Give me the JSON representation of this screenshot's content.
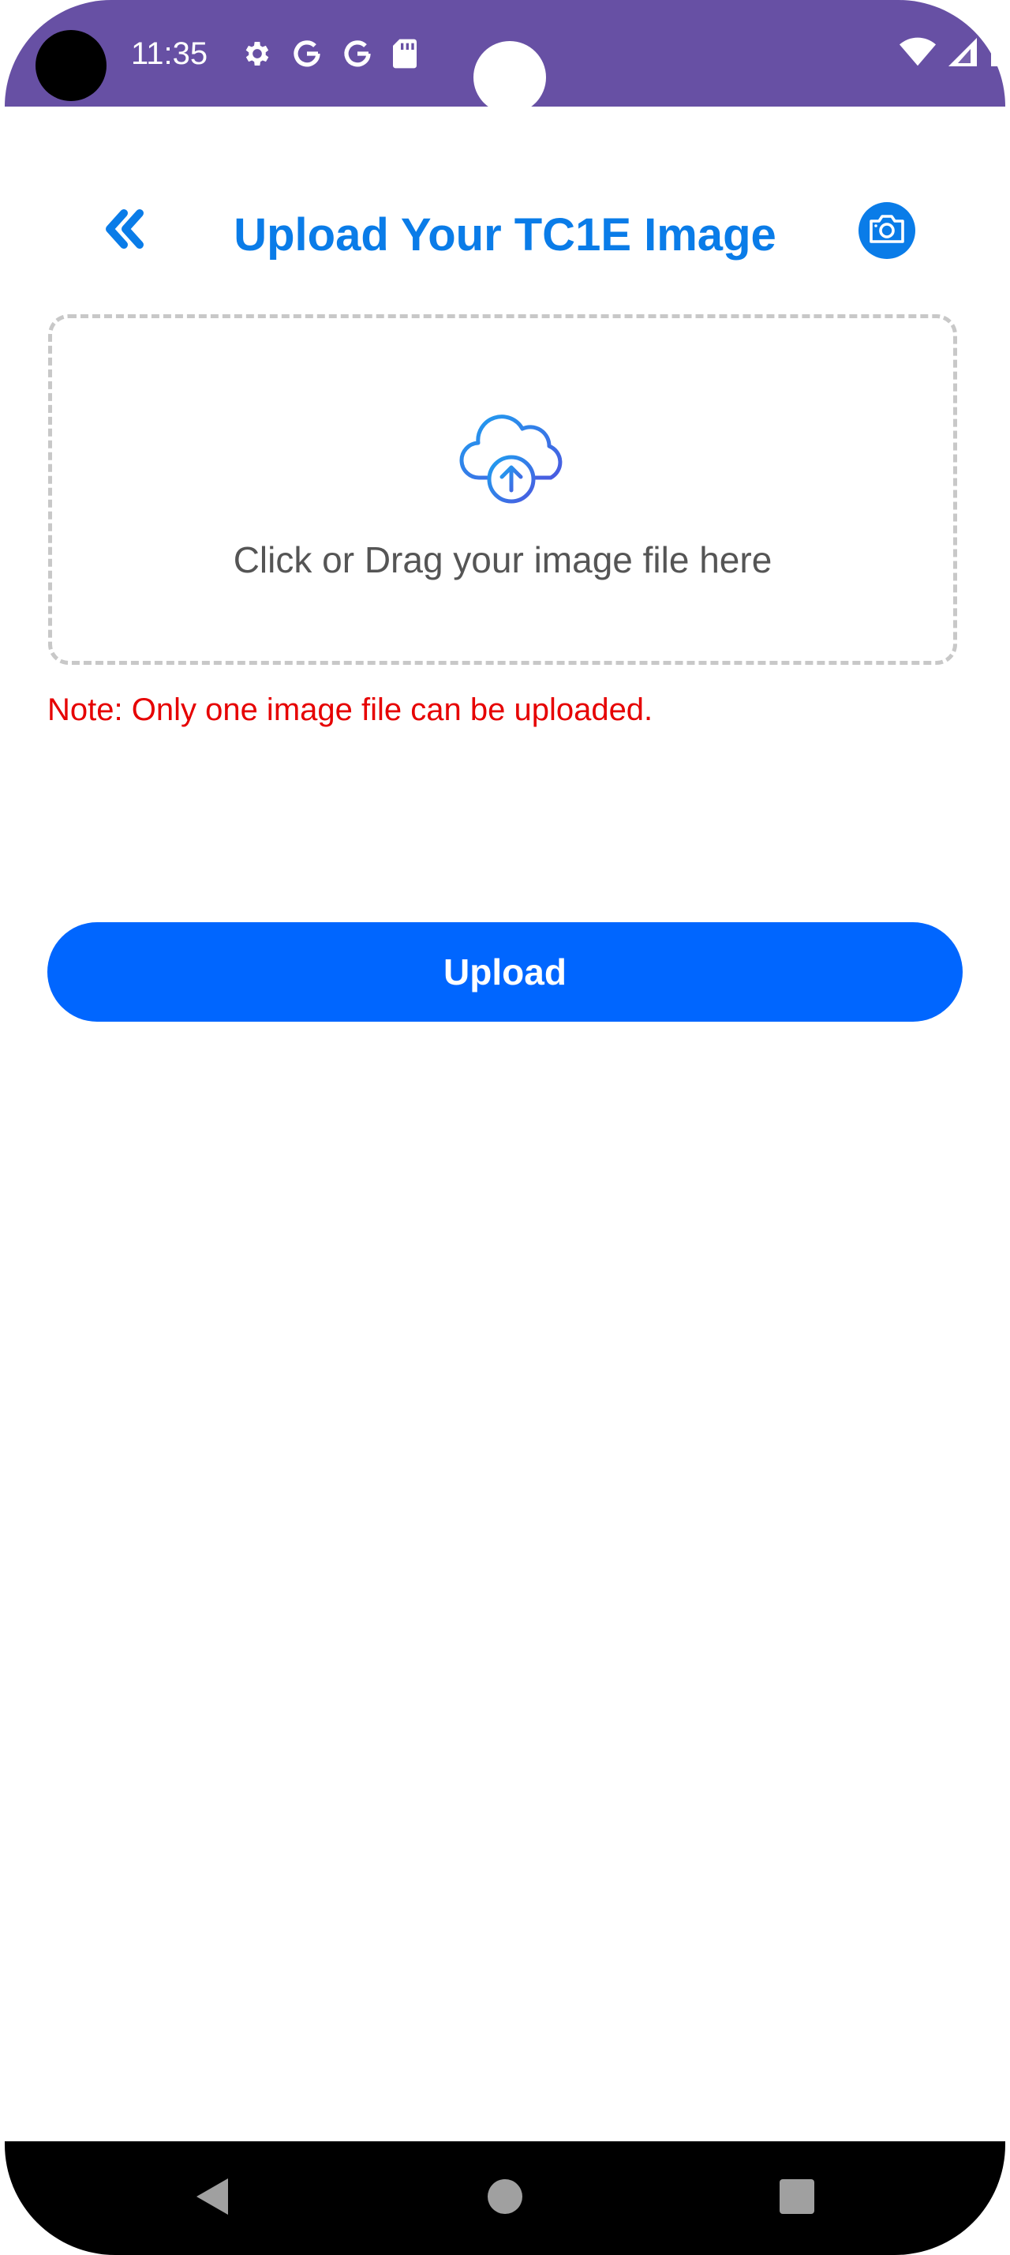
{
  "status_bar": {
    "time": "11:35",
    "background_color": "#6750a4",
    "left_icons": [
      "gear-icon",
      "google-icon",
      "google-icon",
      "sd-card-icon"
    ],
    "right_icons": [
      "wifi-icon",
      "signal-icon",
      "battery-icon"
    ]
  },
  "header": {
    "title": "Upload Your TC1E Image",
    "back_icon": "double-chevron-left-icon",
    "camera_icon": "camera-icon",
    "accent_color": "#0a7ce8"
  },
  "drop_zone": {
    "icon": "cloud-upload-icon",
    "text": "Click or Drag your image file here"
  },
  "note": {
    "text": "Note: Only one image file can be uploaded.",
    "color": "#e60000"
  },
  "upload_button": {
    "label": "Upload",
    "color": "#0066ff"
  },
  "nav_bar": {
    "buttons": [
      "back-triangle-icon",
      "home-circle-icon",
      "recents-square-icon"
    ]
  }
}
